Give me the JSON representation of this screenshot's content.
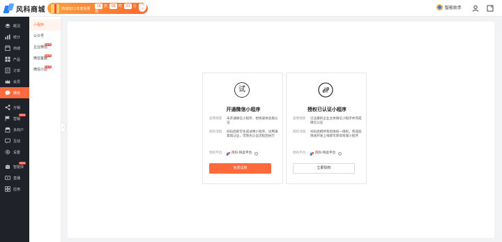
{
  "header": {
    "logo_text": "风科商城",
    "promo": {
      "text": "商城双11年度钜惠",
      "countdown": [
        {
          "value": "16",
          "unit": "天"
        },
        {
          "value": "08",
          "unit": "时"
        },
        {
          "value": "33",
          "unit": "分"
        },
        {
          "value": "41",
          "unit": "秒"
        }
      ],
      "arrow_icon": "chevron-right-icon"
    },
    "assistant_label": "智能助手"
  },
  "sidebar": {
    "items": [
      {
        "label": "概况",
        "icon": "layers-icon",
        "badge": ""
      },
      {
        "label": "统计",
        "icon": "chart-icon",
        "badge": ""
      },
      {
        "label": "商城",
        "icon": "store-icon",
        "badge": ""
      },
      {
        "label": "产品",
        "icon": "grid-icon",
        "badge": ""
      },
      {
        "label": "订单",
        "icon": "order-icon",
        "badge": ""
      },
      {
        "label": "会员",
        "icon": "crown-icon",
        "badge": ""
      },
      {
        "label": "微信",
        "icon": "chat-icon",
        "badge": "",
        "active": true
      }
    ],
    "items2": [
      {
        "label": "分销",
        "icon": "share-icon",
        "badge": ""
      },
      {
        "label": "营销",
        "icon": "flag-icon",
        "badge": "NEW"
      },
      {
        "label": "多商户",
        "icon": "shop-icon",
        "badge": ""
      },
      {
        "label": "互动",
        "icon": "message-icon",
        "badge": ""
      },
      {
        "label": "设置",
        "icon": "gear-icon",
        "badge": ""
      }
    ],
    "items3": [
      {
        "label": "智能体",
        "icon": "robot-icon",
        "badge": "NEW"
      },
      {
        "label": "直播",
        "icon": "tv-icon",
        "badge": ""
      },
      {
        "label": "应用",
        "icon": "apps-icon",
        "badge": ""
      }
    ]
  },
  "submenu": {
    "items": [
      {
        "label": "小程序",
        "badge": "",
        "active": true
      },
      {
        "label": "公众号",
        "badge": ""
      },
      {
        "label": "企业微信",
        "badge": "NEW"
      },
      {
        "label": "微信客服",
        "badge": "NEW"
      },
      {
        "label": "微信小店",
        "badge": "NEW"
      }
    ]
  },
  "cards": [
    {
      "icon_char": "试",
      "icon": "trial-icon",
      "title": "开通微信小程序",
      "scene_label": "适用场景",
      "scene_value": "未开通微信小程序，想快速体验再认证",
      "flow_label": "授权流程",
      "flow_value": "扫码后即可生成试用小程序，试用满意再认证，可暂也认证流程后执行",
      "platform_label": "授权平台",
      "platform_value": "风科-快卖平台",
      "button_label": "免费试用"
    },
    {
      "icon_char": "",
      "icon": "link-icon",
      "title": "授权已认证小程序",
      "scene_label": "适用场景",
      "scene_value": "已注册的企业主体微信小程序并完成微信认证",
      "flow_label": "授权流程",
      "flow_value": "扫码后把所有权限统一授权，完成后快速开发上线即可获得商城小程序",
      "platform_label": "授权平台",
      "platform_value": "风科-快卖平台",
      "button_label": "立即授权"
    }
  ],
  "colors": {
    "accent": "#ff6a3d",
    "sidebar_bg": "#1f2229",
    "brand_blue": "#2d7cf6"
  }
}
